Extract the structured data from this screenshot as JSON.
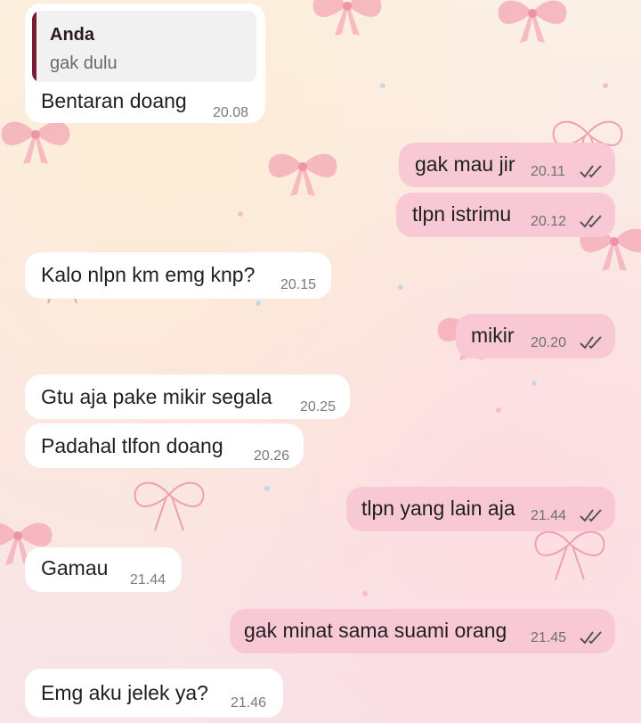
{
  "chat": {
    "quoted": {
      "author": "Anda",
      "text": "gak dulu"
    },
    "messages": [
      {
        "text": "Bentaran doang",
        "time": "20.08",
        "side": "in"
      },
      {
        "text": "gak mau jir",
        "time": "20.11",
        "side": "out",
        "status": "read"
      },
      {
        "text": "tlpn istrimu",
        "time": "20.12",
        "side": "out",
        "status": "read"
      },
      {
        "text": "Kalo nlpn km emg knp?",
        "time": "20.15",
        "side": "in"
      },
      {
        "text": "mikir",
        "time": "20.20",
        "side": "out",
        "status": "read"
      },
      {
        "text": "Gtu aja pake mikir segala",
        "time": "20.25",
        "side": "in"
      },
      {
        "text": "Padahal tlfon doang",
        "time": "20.26",
        "side": "in"
      },
      {
        "text": "tlpn yang lain aja",
        "time": "21.44",
        "side": "out",
        "status": "read"
      },
      {
        "text": "Gamau",
        "time": "21.44",
        "side": "in"
      },
      {
        "text": "gak minat sama suami orang",
        "time": "21.45",
        "side": "out",
        "status": "read"
      },
      {
        "text": "Emg aku jelek ya?",
        "time": "21.46",
        "side": "in"
      }
    ]
  },
  "colors": {
    "incoming_bubble": "#ffffff",
    "outgoing_bubble": "#f8c9d5",
    "quote_bar": "#7a1c35",
    "read_ticks": "#555555"
  },
  "icons": {
    "read_receipt": "double-check-icon",
    "wallpaper_motif": "bow-ribbon-icon"
  }
}
